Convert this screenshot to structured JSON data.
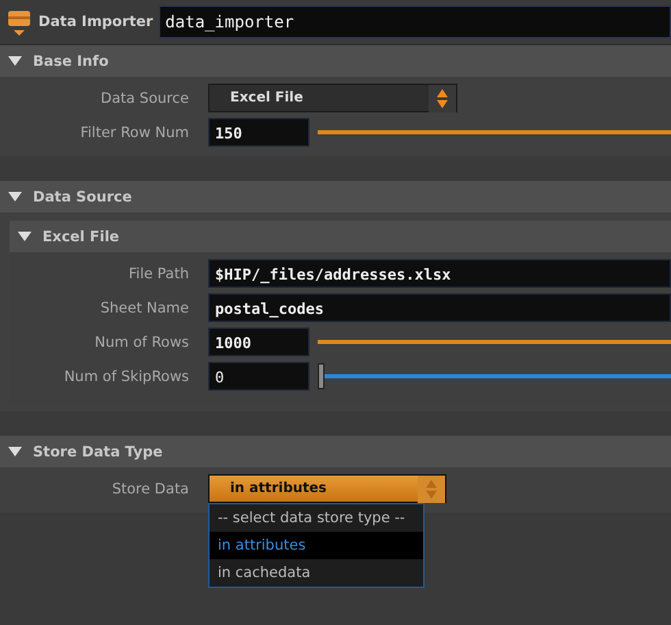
{
  "node": {
    "type_label": "Data Importer",
    "name": "data_importer"
  },
  "sections": [
    {
      "title": "Base Info",
      "expanded": true,
      "rows": [
        {
          "kind": "combo",
          "label": "Data Source",
          "value": "Excel File"
        },
        {
          "kind": "slider",
          "label": "Filter Row Num",
          "value": "150",
          "level": 1
        }
      ]
    },
    {
      "title": "Data Source",
      "expanded": true,
      "subsection": {
        "title": "Excel File",
        "expanded": true,
        "rows": [
          {
            "kind": "text",
            "label": "File Path",
            "value": "$HIP/_files/addresses.xlsx"
          },
          {
            "kind": "text",
            "label": "Sheet Name",
            "value": "postal_codes"
          },
          {
            "kind": "slider",
            "label": "Num of Rows",
            "value": "1000",
            "level": 1
          },
          {
            "kind": "slider",
            "label": "Num of SkipRows",
            "value": "0",
            "level": 0
          }
        ]
      }
    },
    {
      "title": "Store Data Type",
      "expanded": true,
      "rows": [
        {
          "kind": "dropdown",
          "label": "Store Data",
          "value": "in attributes",
          "open": true,
          "options": [
            {
              "label": "-- select data store type --",
              "selected": false
            },
            {
              "label": "in attributes",
              "selected": true
            },
            {
              "label": "in cachedata",
              "selected": false
            }
          ]
        }
      ]
    }
  ]
}
